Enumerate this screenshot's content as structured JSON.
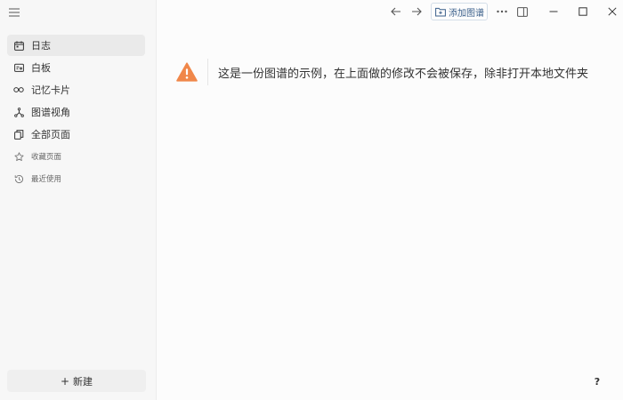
{
  "sidebar": {
    "menu_icon": "hamburger-icon",
    "items": [
      {
        "label": "日志",
        "icon": "calendar-icon",
        "active": true
      },
      {
        "label": "白板",
        "icon": "whiteboard-icon"
      },
      {
        "label": "记忆卡片",
        "icon": "infinity-icon"
      },
      {
        "label": "图谱视角",
        "icon": "graph-icon"
      },
      {
        "label": "全部页面",
        "icon": "pages-icon"
      }
    ],
    "secondary_items": [
      {
        "label": "收藏页面",
        "icon": "star-icon"
      },
      {
        "label": "最近使用",
        "icon": "history-icon"
      }
    ],
    "new_button": {
      "plus": "+",
      "label": "新建"
    }
  },
  "toolbar": {
    "add_graph_label": "添加图谱"
  },
  "notice": {
    "message": "这是一份图谱的示例，在上面做的修改不会被保存，除非打开本地文件夹",
    "accent": "#f0874a"
  },
  "help_label": "?"
}
